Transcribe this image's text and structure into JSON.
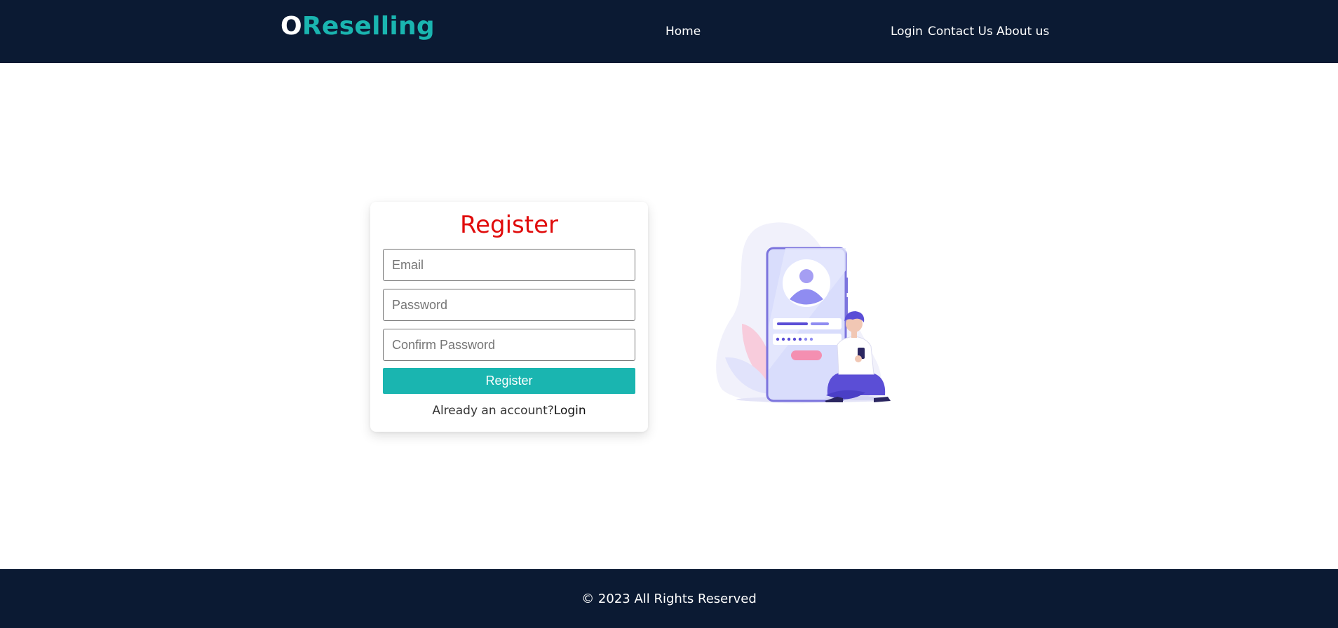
{
  "brand": {
    "first_letter": "O",
    "rest": "Reselling"
  },
  "nav": {
    "home": "Home",
    "login": "Login",
    "contact": "Contact Us",
    "about": "About us"
  },
  "form": {
    "title": "Register",
    "email_placeholder": "Email",
    "password_placeholder": "Password",
    "confirm_placeholder": "Confirm Password",
    "submit_label": "Register",
    "already_text": "Already an account?",
    "login_link": "Login"
  },
  "footer": {
    "text": "© 2023 All Rights Reserved"
  },
  "colors": {
    "navbar_bg": "#0b1a33",
    "accent_teal": "#1ab5b0",
    "title_red": "#e00b0b",
    "illustration_purple": "#5b4ed6"
  },
  "icons": {
    "illustration": "person-with-phone-login-illustration"
  }
}
